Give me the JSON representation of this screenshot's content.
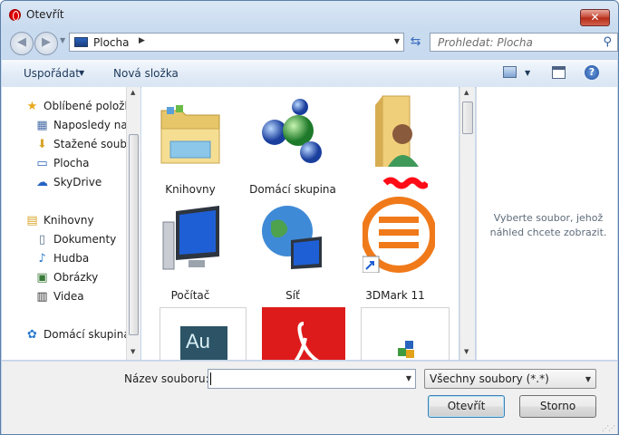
{
  "window": {
    "title": "Otevřít",
    "close_label": "✕"
  },
  "navbar": {
    "back_label": "◀",
    "forward_label": "▶",
    "address": "Plocha",
    "search_placeholder": "Prohledat: Plocha"
  },
  "toolbar": {
    "organize": "Uspořádat",
    "new_folder": "Nová složka"
  },
  "sidebar": {
    "favorites": [
      {
        "label": "Oblíbené položky",
        "icon": "star-icon"
      },
      {
        "label": "Naposledy navštívené",
        "icon": "recent-places-icon"
      },
      {
        "label": "Stažené soubory",
        "icon": "downloads-icon"
      },
      {
        "label": "Plocha",
        "icon": "desktop-icon"
      },
      {
        "label": "SkyDrive",
        "icon": "skydrive-icon"
      }
    ],
    "libraries": [
      {
        "label": "Knihovny",
        "icon": "libraries-icon"
      },
      {
        "label": "Dokumenty",
        "icon": "documents-icon"
      },
      {
        "label": "Hudba",
        "icon": "music-icon"
      },
      {
        "label": "Obrázky",
        "icon": "pictures-icon"
      },
      {
        "label": "Videa",
        "icon": "videos-icon"
      }
    ],
    "homegroup": {
      "label": "Domácí skupina",
      "icon": "homegroup-icon"
    }
  },
  "files": [
    {
      "name": "Knihovny",
      "icon": "libraries-folder-icon"
    },
    {
      "name": "Domácí skupina",
      "icon": "homegroup-icon"
    },
    {
      "name": "",
      "icon": "user-folder-icon"
    },
    {
      "name": "Počítač",
      "icon": "computer-icon"
    },
    {
      "name": "Síť",
      "icon": "network-icon"
    },
    {
      "name": "3DMark 11",
      "icon": "3dmark-icon"
    },
    {
      "name": "",
      "icon": "adobe-audition-icon",
      "text": "Au"
    },
    {
      "name": "",
      "icon": "adobe-reader-icon"
    },
    {
      "name": "",
      "icon": "installer-icon"
    }
  ],
  "preview": {
    "message": "Vyberte soubor, jehož náhled chcete zobrazit."
  },
  "footer": {
    "filename_label": "Název souboru:",
    "filename_value": "",
    "filetype": "Všechny soubory (*.*)",
    "open_label": "Otevřít",
    "cancel_label": "Storno"
  }
}
